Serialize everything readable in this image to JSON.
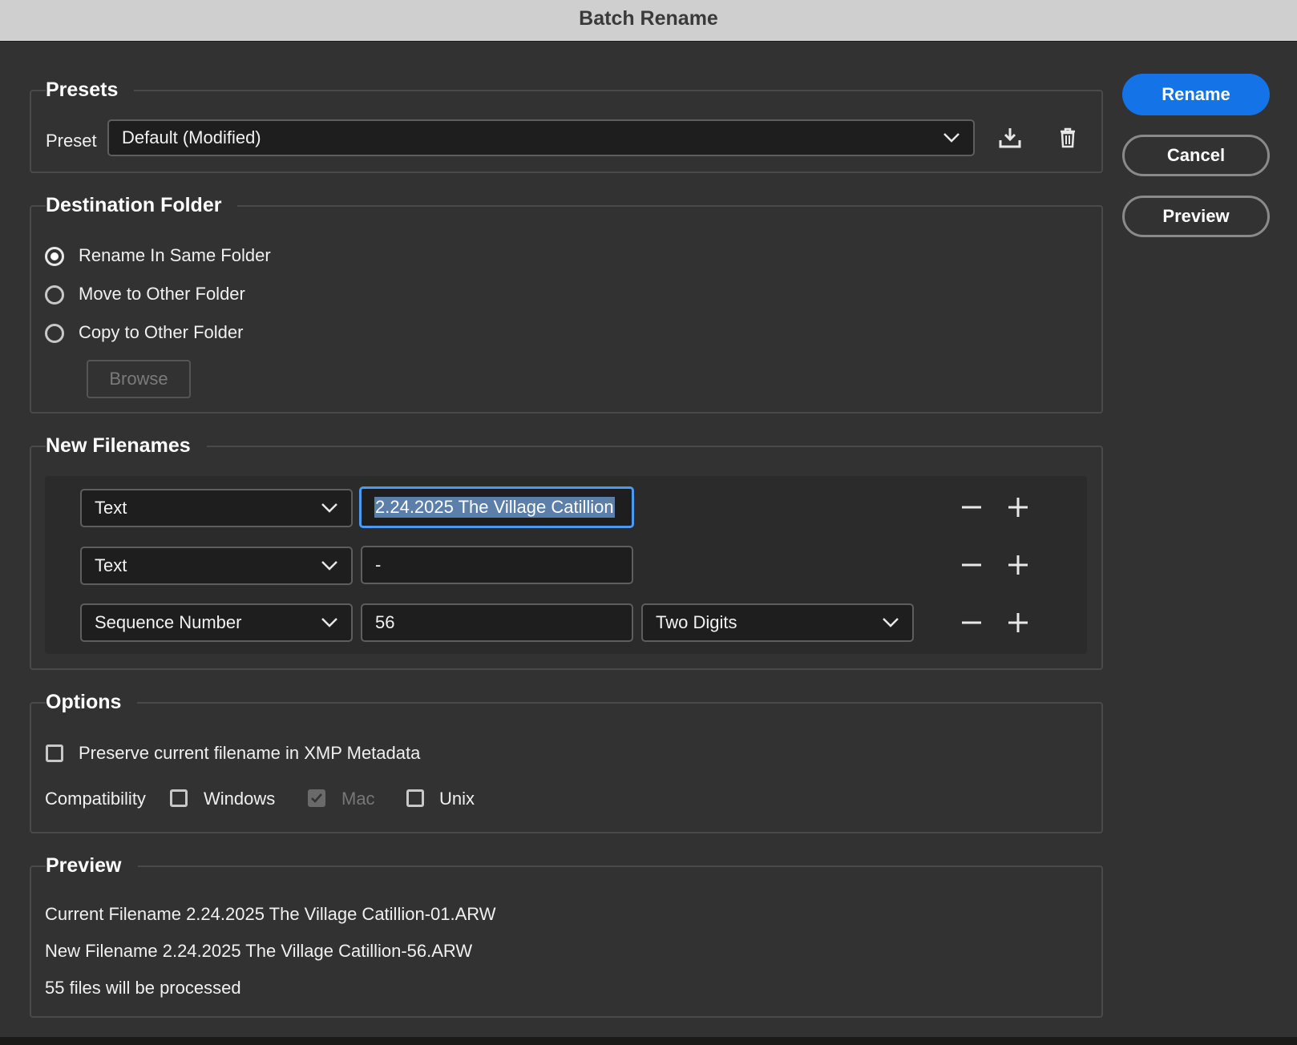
{
  "window": {
    "title": "Batch Rename"
  },
  "actions": {
    "rename": "Rename",
    "cancel": "Cancel",
    "preview": "Preview"
  },
  "presets": {
    "legend": "Presets",
    "label": "Preset",
    "selected": "Default (Modified)",
    "save_icon": "download-icon",
    "delete_icon": "trash-icon"
  },
  "destination": {
    "legend": "Destination Folder",
    "options": [
      {
        "label": "Rename In Same Folder",
        "checked": true
      },
      {
        "label": "Move to Other Folder",
        "checked": false
      },
      {
        "label": "Copy to Other Folder",
        "checked": false
      }
    ],
    "browse": "Browse"
  },
  "filenames": {
    "legend": "New Filenames",
    "rows": [
      {
        "type": "Text",
        "value": "2.24.2025 The Village Catillion"
      },
      {
        "type": "Text",
        "value": "-"
      },
      {
        "type": "Sequence Number",
        "value": "56",
        "format": "Two Digits"
      }
    ]
  },
  "options": {
    "legend": "Options",
    "preserve": {
      "label": "Preserve current filename in XMP Metadata",
      "checked": false
    },
    "compat_label": "Compatibility",
    "compat": [
      {
        "label": "Windows",
        "checked": false
      },
      {
        "label": "Mac",
        "checked": true,
        "disabled": true
      },
      {
        "label": "Unix",
        "checked": false
      }
    ]
  },
  "preview": {
    "legend": "Preview",
    "current": "Current Filename 2.24.2025 The Village Catillion-01.ARW",
    "new": "New Filename 2.24.2025 The Village Catillion-56.ARW",
    "count": "55 files will be processed"
  },
  "colors": {
    "accent": "#1473e6",
    "focus": "#4a9af5",
    "background": "#323232"
  }
}
